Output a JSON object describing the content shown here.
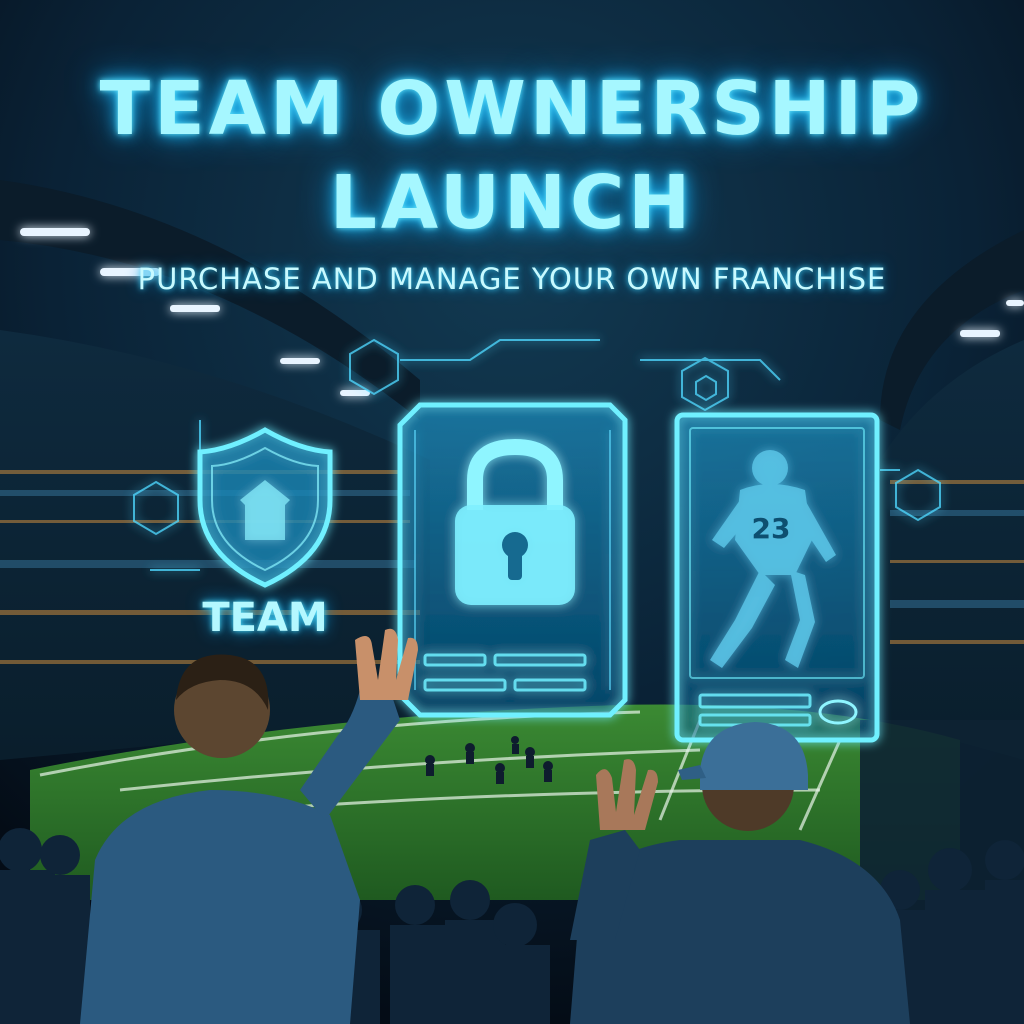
{
  "headline": {
    "line1": "TEAM OWNERSHIP",
    "line2": "LAUNCH",
    "subtitle": "PURCHASE AND MANAGE YOUR OWN FRANCHISE"
  },
  "hologram": {
    "shield_label": "TEAM",
    "player_jersey_number": "23"
  },
  "icons": [
    "shield-icon",
    "lock-icon",
    "football-icon",
    "hexagon-icon"
  ],
  "colors": {
    "glow": "#5fe6ff",
    "text": "#a6f7ff",
    "night_sky": "#06121f",
    "field": "#2f7a2c"
  }
}
